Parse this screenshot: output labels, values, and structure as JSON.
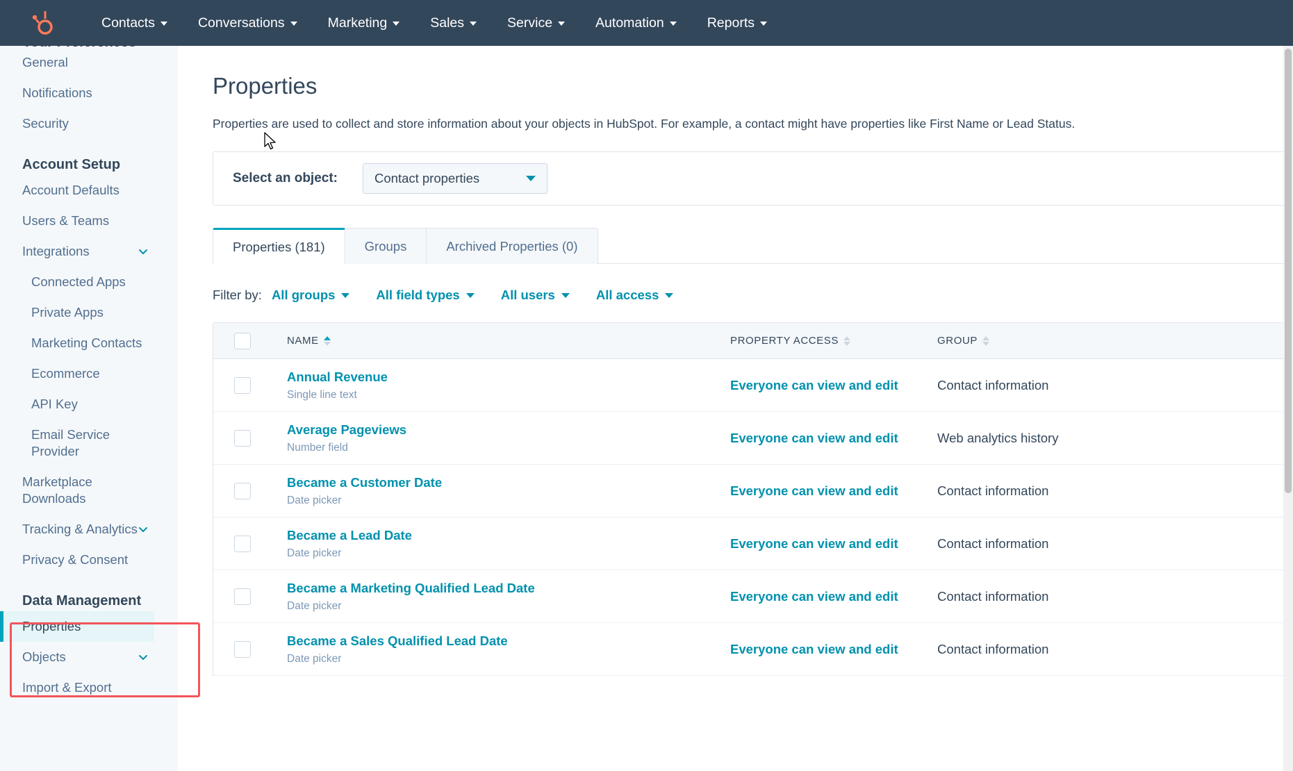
{
  "topnav": {
    "logo_icon": "hubspot-sprocket-logo",
    "items": [
      {
        "label": "Contacts",
        "caret": true
      },
      {
        "label": "Conversations",
        "caret": true
      },
      {
        "label": "Marketing",
        "caret": true
      },
      {
        "label": "Sales",
        "caret": true
      },
      {
        "label": "Service",
        "caret": true
      },
      {
        "label": "Automation",
        "caret": true
      },
      {
        "label": "Reports",
        "caret": true
      }
    ]
  },
  "sidebar": {
    "preferences_heading": "Your Preferences",
    "preferences_items": [
      {
        "label": "General"
      },
      {
        "label": "Notifications"
      },
      {
        "label": "Security"
      }
    ],
    "account_setup_heading": "Account Setup",
    "account_setup_items": [
      {
        "label": "Account Defaults",
        "chevron": false,
        "sub": false
      },
      {
        "label": "Users & Teams",
        "chevron": false,
        "sub": false
      },
      {
        "label": "Integrations",
        "chevron": true,
        "sub": false
      },
      {
        "label": "Connected Apps",
        "chevron": false,
        "sub": true
      },
      {
        "label": "Private Apps",
        "chevron": false,
        "sub": true
      },
      {
        "label": "Marketing Contacts",
        "chevron": false,
        "sub": true
      },
      {
        "label": "Ecommerce",
        "chevron": false,
        "sub": true
      },
      {
        "label": "API Key",
        "chevron": false,
        "sub": true
      },
      {
        "label": "Email Service Provider",
        "chevron": false,
        "sub": true
      },
      {
        "label": "Marketplace Downloads",
        "chevron": false,
        "sub": false
      },
      {
        "label": "Tracking & Analytics",
        "chevron": true,
        "sub": false
      },
      {
        "label": "Privacy & Consent",
        "chevron": false,
        "sub": false
      }
    ],
    "data_management_heading": "Data Management",
    "data_management_items": [
      {
        "label": "Properties",
        "chevron": false,
        "selected": true
      },
      {
        "label": "Objects",
        "chevron": true,
        "selected": false
      },
      {
        "label": "Import & Export",
        "chevron": false,
        "selected": false
      }
    ],
    "annotation_color": "#f2545b",
    "selected_accent_color": "#00a4bd"
  },
  "main": {
    "title": "Properties",
    "description": "Properties are used to collect and store information about your objects in HubSpot. For example, a contact might have properties like First Name or Lead Status.",
    "object_selector": {
      "label": "Select an object:",
      "value": "Contact properties"
    },
    "tabs": [
      {
        "label": "Properties (181)",
        "active": true
      },
      {
        "label": "Groups",
        "active": false
      },
      {
        "label": "Archived Properties (0)",
        "active": false
      }
    ],
    "filters": {
      "label": "Filter by:",
      "items": [
        {
          "label": "All groups"
        },
        {
          "label": "All field types"
        },
        {
          "label": "All users"
        },
        {
          "label": "All access"
        }
      ]
    },
    "table": {
      "columns": [
        {
          "key": "name",
          "label": "NAME",
          "sorted": "asc"
        },
        {
          "key": "access",
          "label": "PROPERTY ACCESS",
          "sorted": "none"
        },
        {
          "key": "group",
          "label": "GROUP",
          "sorted": "none"
        }
      ],
      "rows": [
        {
          "name": "Annual Revenue",
          "type": "Single line text",
          "access": "Everyone can view and edit",
          "group": "Contact information"
        },
        {
          "name": "Average Pageviews",
          "type": "Number field",
          "access": "Everyone can view and edit",
          "group": "Web analytics history"
        },
        {
          "name": "Became a Customer Date",
          "type": "Date picker",
          "access": "Everyone can view and edit",
          "group": "Contact information"
        },
        {
          "name": "Became a Lead Date",
          "type": "Date picker",
          "access": "Everyone can view and edit",
          "group": "Contact information"
        },
        {
          "name": "Became a Marketing Qualified Lead Date",
          "type": "Date picker",
          "access": "Everyone can view and edit",
          "group": "Contact information"
        },
        {
          "name": "Became a Sales Qualified Lead Date",
          "type": "Date picker",
          "access": "Everyone can view and edit",
          "group": "Contact information"
        }
      ]
    }
  },
  "colors": {
    "nav_bg": "#33475b",
    "link": "#0091ae",
    "accent": "#00a4bd",
    "sidebar_bg": "#f5f8fa",
    "annotation": "#f2545b"
  }
}
